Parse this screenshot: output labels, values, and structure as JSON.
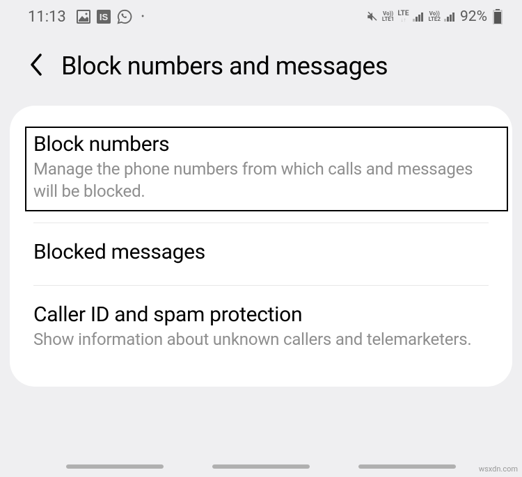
{
  "statusBar": {
    "time": "11:13",
    "batteryPct": "92%"
  },
  "header": {
    "title": "Block numbers and messages"
  },
  "items": {
    "blockNumbers": {
      "title": "Block numbers",
      "subtitle": "Manage the phone numbers from which calls and messages will be blocked."
    },
    "blockedMessages": {
      "title": "Blocked messages"
    },
    "callerId": {
      "title": "Caller ID and spam protection",
      "subtitle": "Show information about unknown callers and telemarketers."
    }
  },
  "watermark": "wsxdn.com"
}
